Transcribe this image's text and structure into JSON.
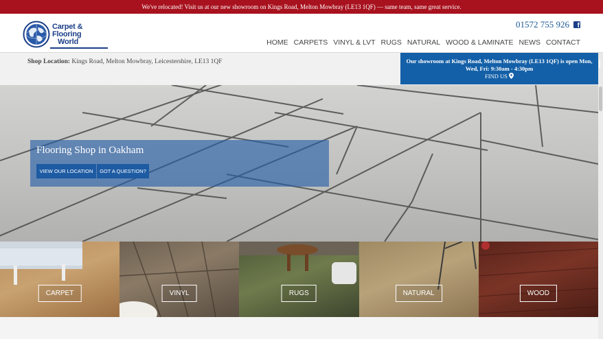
{
  "announcement": "We've relocated! Visit us at our new showroom on Kings Road, Melton Mowbray (LE13 1QF) — same team, same great service.",
  "logo": {
    "line1": "Carpet &",
    "line2": "Flooring",
    "line3": "World"
  },
  "phone": "01572 755 926",
  "nav": [
    "HOME",
    "CARPETS",
    "VINYL & LVT",
    "RUGS",
    "NATURAL",
    "WOOD & LAMINATE",
    "NEWS",
    "CONTACT"
  ],
  "location": {
    "label": "Shop Location:",
    "address": "Kings Road, Melton Mowbray, Leicestershire, LE13 1QF"
  },
  "showroom": {
    "text": "Our showroom at Kings Road, Melton Mowbray (LE13 1QF) is open Mon, Wed, Fri: 9:30am - 4:30pm",
    "find_label": "FIND US"
  },
  "hero": {
    "title": "Flooring Shop in Oakham",
    "btn_location": "VIEW OUR LOCATION",
    "btn_question": "GOT A QUESTION?"
  },
  "tiles": [
    {
      "label": "CARPET"
    },
    {
      "label": "VINYL"
    },
    {
      "label": "RUGS"
    },
    {
      "label": "NATURAL"
    },
    {
      "label": "WOOD"
    }
  ],
  "colors": {
    "announcement_bg": "#a8121e",
    "brand_blue": "#1b3e87",
    "showroom_bg": "#1460a8"
  },
  "icons": [
    "globe-logo",
    "facebook-icon",
    "map-pin-icon"
  ]
}
